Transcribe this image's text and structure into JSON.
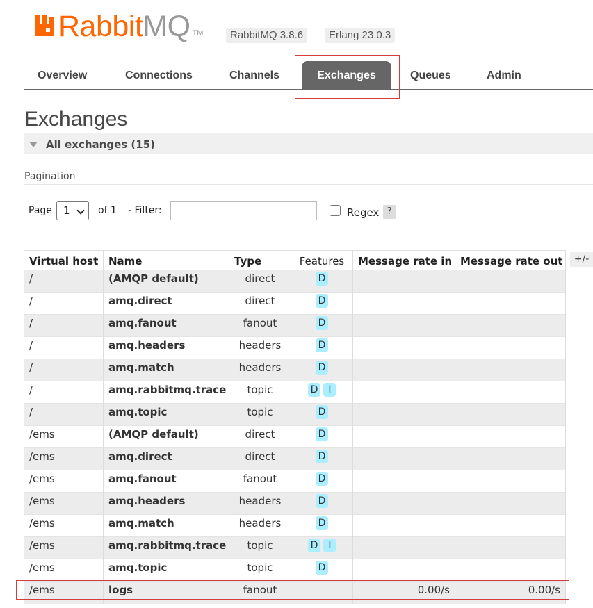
{
  "header": {
    "logo_text_main": "Rabbit",
    "logo_text_mq": "MQ",
    "logo_tm": "TM",
    "rabbitmq_version": "RabbitMQ 3.8.6",
    "erlang_version": "Erlang 23.0.3",
    "brand_color": "#ff6600"
  },
  "tabs": [
    {
      "label": "Overview"
    },
    {
      "label": "Connections"
    },
    {
      "label": "Channels"
    },
    {
      "label": "Exchanges",
      "active": true
    },
    {
      "label": "Queues"
    },
    {
      "label": "Admin"
    }
  ],
  "page_title": "Exchanges",
  "section": {
    "label": "All exchanges (15)"
  },
  "pagination": {
    "title": "Pagination",
    "page_label": "Page",
    "page_value": "1",
    "of_label": "of 1",
    "filter_label": "- Filter:",
    "filter_value": "",
    "regex_label": "Regex",
    "regex_checked": false,
    "help_label": "?"
  },
  "table": {
    "columns": [
      "Virtual host",
      "Name",
      "Type",
      "Features",
      "Message rate in",
      "Message rate out"
    ],
    "toggle_label": "+/-",
    "rows": [
      {
        "vhost": "/",
        "name": "(AMQP default)",
        "type": "direct",
        "features": [
          "D"
        ],
        "rate_in": "",
        "rate_out": ""
      },
      {
        "vhost": "/",
        "name": "amq.direct",
        "type": "direct",
        "features": [
          "D"
        ],
        "rate_in": "",
        "rate_out": ""
      },
      {
        "vhost": "/",
        "name": "amq.fanout",
        "type": "fanout",
        "features": [
          "D"
        ],
        "rate_in": "",
        "rate_out": ""
      },
      {
        "vhost": "/",
        "name": "amq.headers",
        "type": "headers",
        "features": [
          "D"
        ],
        "rate_in": "",
        "rate_out": ""
      },
      {
        "vhost": "/",
        "name": "amq.match",
        "type": "headers",
        "features": [
          "D"
        ],
        "rate_in": "",
        "rate_out": ""
      },
      {
        "vhost": "/",
        "name": "amq.rabbitmq.trace",
        "type": "topic",
        "features": [
          "D",
          "I"
        ],
        "rate_in": "",
        "rate_out": ""
      },
      {
        "vhost": "/",
        "name": "amq.topic",
        "type": "topic",
        "features": [
          "D"
        ],
        "rate_in": "",
        "rate_out": ""
      },
      {
        "vhost": "/ems",
        "name": "(AMQP default)",
        "type": "direct",
        "features": [
          "D"
        ],
        "rate_in": "",
        "rate_out": ""
      },
      {
        "vhost": "/ems",
        "name": "amq.direct",
        "type": "direct",
        "features": [
          "D"
        ],
        "rate_in": "",
        "rate_out": ""
      },
      {
        "vhost": "/ems",
        "name": "amq.fanout",
        "type": "fanout",
        "features": [
          "D"
        ],
        "rate_in": "",
        "rate_out": ""
      },
      {
        "vhost": "/ems",
        "name": "amq.headers",
        "type": "headers",
        "features": [
          "D"
        ],
        "rate_in": "",
        "rate_out": ""
      },
      {
        "vhost": "/ems",
        "name": "amq.match",
        "type": "headers",
        "features": [
          "D"
        ],
        "rate_in": "",
        "rate_out": ""
      },
      {
        "vhost": "/ems",
        "name": "amq.rabbitmq.trace",
        "type": "topic",
        "features": [
          "D",
          "I"
        ],
        "rate_in": "",
        "rate_out": ""
      },
      {
        "vhost": "/ems",
        "name": "amq.topic",
        "type": "topic",
        "features": [
          "D"
        ],
        "rate_in": "",
        "rate_out": ""
      },
      {
        "vhost": "/ems",
        "name": "logs",
        "type": "fanout",
        "features": [],
        "rate_in": "0.00/s",
        "rate_out": "0.00/s"
      }
    ]
  }
}
